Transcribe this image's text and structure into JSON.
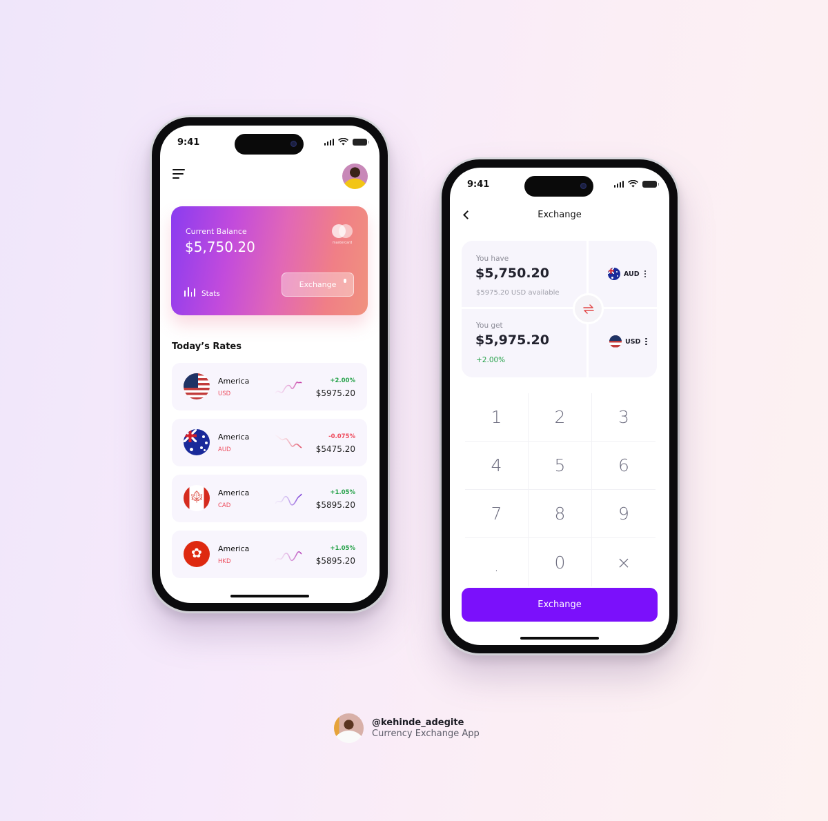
{
  "background": {
    "from": "#efe6fa",
    "to": "#fdf2f1"
  },
  "home_screen": {
    "status_time": "9:41",
    "balance_card": {
      "label": "Current Balance",
      "amount": "$5,750.20",
      "card_brand": "mastercard",
      "stats_label": "Stats",
      "exchange_label": "Exchange"
    },
    "rates_title": "Today’s Rates",
    "rates": [
      {
        "country": "America",
        "code": "USD",
        "flag": "us-flag-icon",
        "change": "+2.00%",
        "direction": "up",
        "value": "$5975.20"
      },
      {
        "country": "America",
        "code": "AUD",
        "flag": "au-flag-icon",
        "change": "-0.075%",
        "direction": "down",
        "value": "$5475.20"
      },
      {
        "country": "America",
        "code": "CAD",
        "flag": "ca-flag-icon",
        "change": "+1.05%",
        "direction": "up",
        "value": "$5895.20"
      },
      {
        "country": "America",
        "code": "HKD",
        "flag": "hk-flag-icon",
        "change": "+1.05%",
        "direction": "up",
        "value": "$5895.20"
      }
    ]
  },
  "exchange_screen": {
    "status_time": "9:41",
    "title": "Exchange",
    "you_have": {
      "label": "You have",
      "amount": "$5,750.20",
      "available": "$5975.20 USD available",
      "currency": "AUD"
    },
    "you_get": {
      "label": "You get",
      "amount": "$5,975.20",
      "change": "+2.00%",
      "currency": "USD"
    },
    "keypad": [
      "1",
      "2",
      "3",
      "4",
      "5",
      "6",
      "7",
      "8",
      "9",
      ".",
      "0",
      "×"
    ],
    "submit_label": "Exchange",
    "accent": "#7b10fb"
  },
  "credit": {
    "handle": "@kehinde_adegite",
    "description": "Currency Exchange App"
  }
}
